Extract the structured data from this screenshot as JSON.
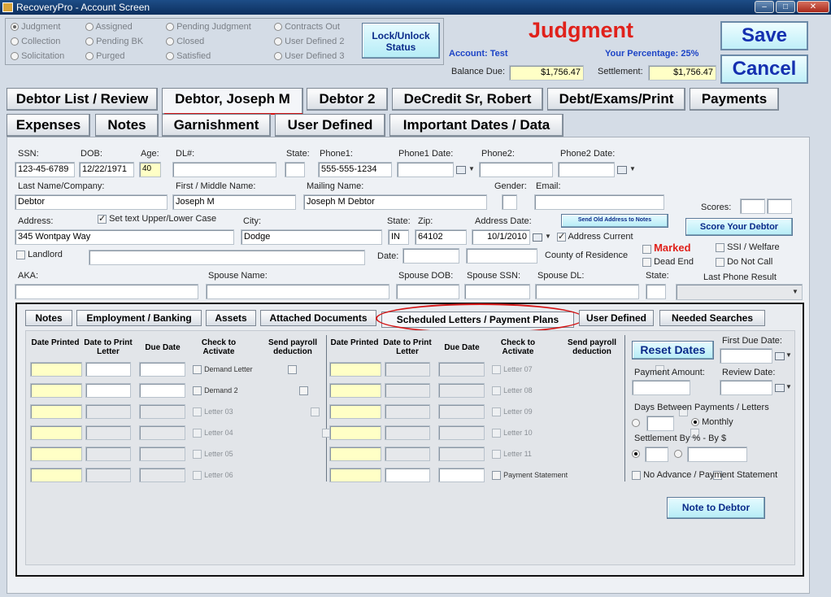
{
  "window": {
    "title": "RecoveryPro - Account Screen"
  },
  "status_options": {
    "col1": [
      "Judgment",
      "Collection",
      "Solicitation"
    ],
    "col2": [
      "Assigned",
      "Pending BK",
      "Purged"
    ],
    "col3": [
      "Pending Judgment",
      "Closed",
      "Satisfied"
    ],
    "col4": [
      "Contracts Out",
      "User Defined 2",
      "User Defined 3"
    ],
    "selected": "Judgment"
  },
  "lock_button": {
    "line1": "Lock/Unlock",
    "line2": "Status"
  },
  "header": {
    "status_title": "Judgment",
    "account_label": "Account:",
    "account_value": "Test",
    "percentage_label": "Your Percentage:",
    "percentage_value": "25%",
    "balance_label": "Balance Due:",
    "balance_value": "$1,756.47",
    "settlement_label": "Settlement:",
    "settlement_value": "$1,756.47"
  },
  "actions": {
    "save": "Save",
    "cancel": "Cancel"
  },
  "main_tabs": {
    "row1": [
      "Debtor List / Review",
      "Debtor, Joseph M",
      "Debtor 2",
      "DeCredit Sr, Robert",
      "Debt/Exams/Print",
      "Payments"
    ],
    "row2": [
      "Expenses",
      "Notes",
      "Garnishment",
      "User Defined",
      "Important Dates / Data"
    ],
    "active": "Debtor, Joseph M"
  },
  "debtor": {
    "labels": {
      "ssn": "SSN:",
      "dob": "DOB:",
      "age": "Age:",
      "dl": "DL#:",
      "state": "State:",
      "phone1": "Phone1:",
      "phone1_date": "Phone1 Date:",
      "phone2": "Phone2:",
      "phone2_date": "Phone2 Date:",
      "last_name": "Last Name/Company:",
      "first_middle": "First / Middle Name:",
      "mailing_name": "Mailing Name:",
      "gender": "Gender:",
      "email": "Email:",
      "scores": "Scores:",
      "address": "Address:",
      "text_case": "Set text Upper/Lower Case",
      "city": "City:",
      "zip": "Zip:",
      "address_date": "Address Date:",
      "address_current": "Address Current",
      "landlord": "Landlord",
      "date": "Date:",
      "county": "County of Residence",
      "aka": "AKA:",
      "spouse_name": "Spouse Name:",
      "spouse_dob": "Spouse DOB:",
      "spouse_ssn": "Spouse SSN:",
      "spouse_dl": "Spouse DL:",
      "spouse_state": "State:",
      "last_phone_result": "Last Phone Result",
      "marked": "Marked",
      "ssi": "SSI / Welfare",
      "dead_end": "Dead End",
      "do_not_call": "Do Not Call"
    },
    "values": {
      "ssn": "123-45-6789",
      "dob": "12/22/1971",
      "age": "40",
      "phone1": "555-555-1234",
      "last_name": "Debtor",
      "first_middle": "Joseph M",
      "mailing_name": "Joseph M Debtor",
      "address": "345 Wontpay Way",
      "city": "Dodge",
      "state": "IN",
      "zip": "64102",
      "address_date": "10/1/2010"
    },
    "send_old_address": "Send Old Address to Notes",
    "score_button": "Score Your Debtor"
  },
  "sub_tabs": {
    "items": [
      "Notes",
      "Employment / Banking",
      "Assets",
      "Attached Documents",
      "Scheduled Letters  /  Payment Plans",
      "User Defined",
      "Needed Searches"
    ],
    "active": "Scheduled Letters  /  Payment Plans"
  },
  "letters": {
    "headers": [
      "Date Printed",
      "Date to Print Letter",
      "Due Date",
      "Check to Activate",
      "Send payroll deduction"
    ],
    "left": [
      "Demand Letter",
      "Demand 2",
      "Letter 03",
      "Letter 04",
      "Letter 05",
      "Letter 06"
    ],
    "right": [
      "Letter 07",
      "Letter 08",
      "Letter 09",
      "Letter 10",
      "Letter 11",
      "Payment Statement"
    ]
  },
  "payment_plan": {
    "reset": "Reset Dates",
    "first_due": "First Due Date:",
    "payment_amount": "Payment Amount:",
    "review_date": "Review Date:",
    "days_between": "Days Between Payments / Letters",
    "monthly": "Monthly",
    "settlement_by": "Settlement By %  -  By $",
    "no_advance": "No Advance / Payment Statement",
    "note_to_debtor": "Note to Debtor"
  }
}
